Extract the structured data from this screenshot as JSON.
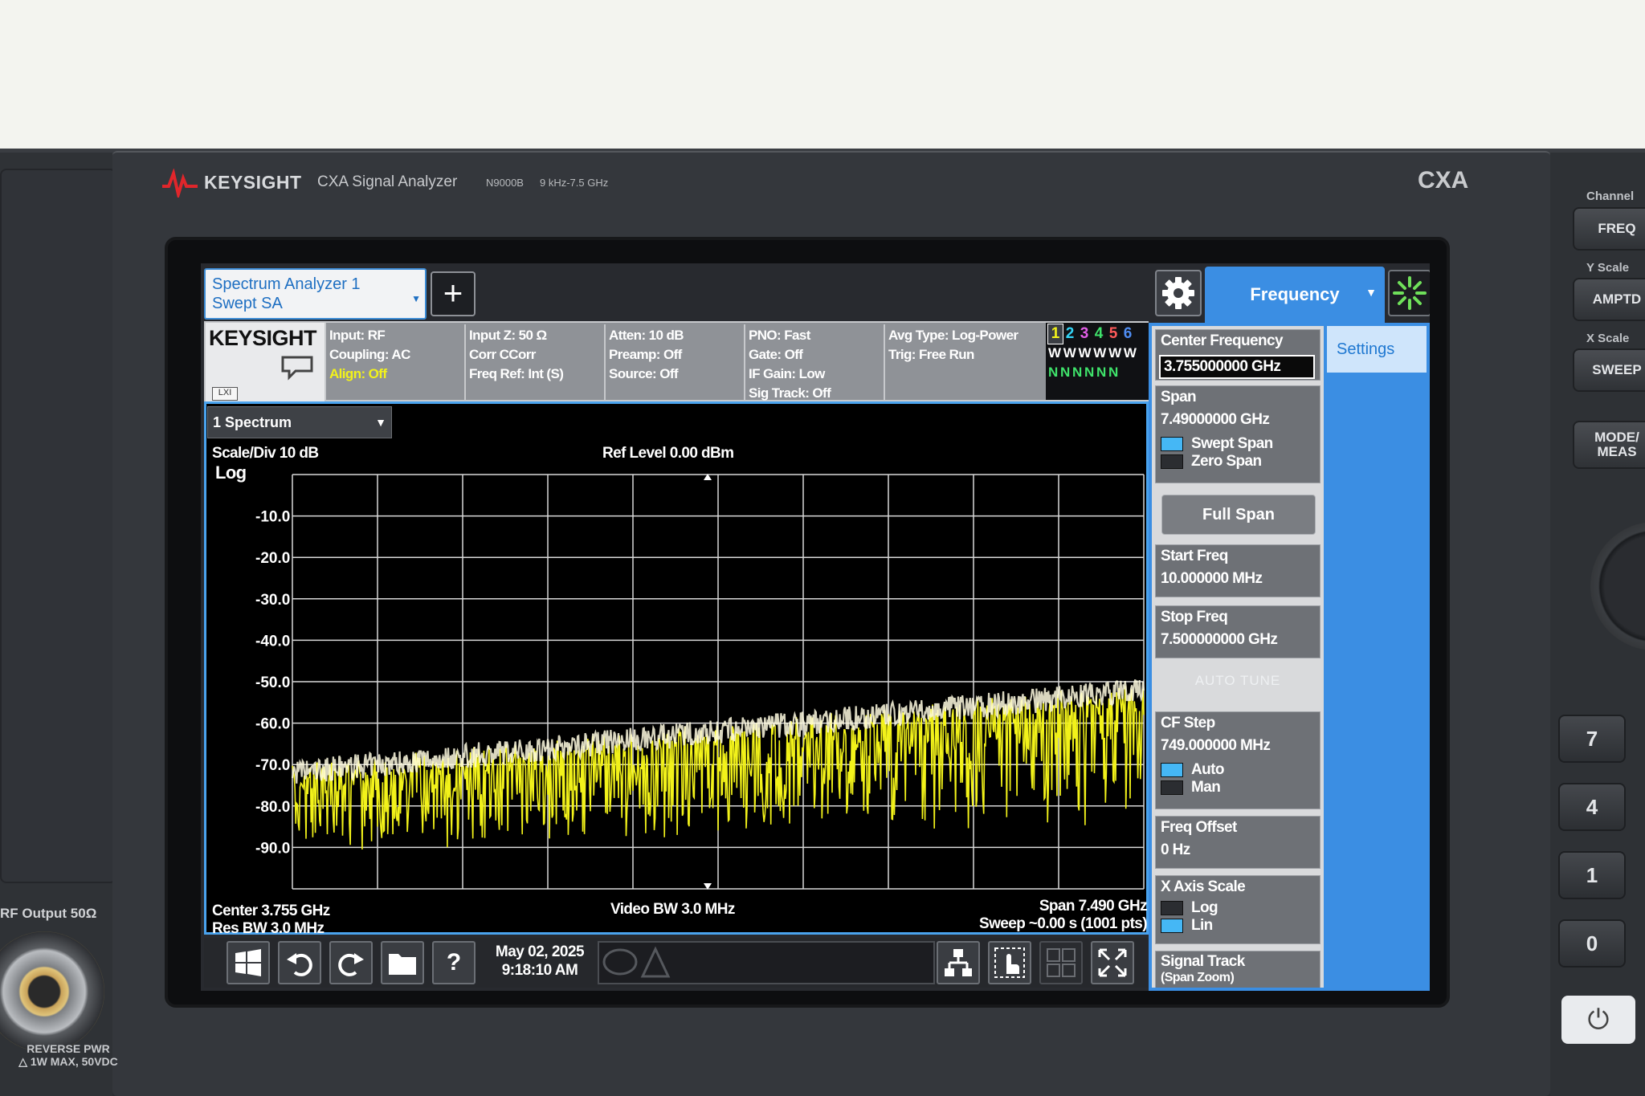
{
  "instrument": {
    "brand": "KEYSIGHT",
    "model_name": "CXA Signal Analyzer",
    "model_number": "N9000B",
    "range": "9 kHz-7.5 GHz",
    "series": "CXA",
    "rf_output_label": "RF Output 50Ω",
    "rf_warning_1": "REVERSE PWR",
    "rf_warning_2": "1W MAX, 50VDC"
  },
  "hardware_keys": {
    "groups": [
      {
        "label": "Channel",
        "key": "FREQ"
      },
      {
        "label": "Y Scale",
        "key": "AMPTD"
      },
      {
        "label": "X Scale",
        "key": "SWEEP"
      }
    ],
    "mode_meas": "MODE/ MEAS",
    "numbers": [
      "7",
      "4",
      "1",
      "0"
    ],
    "power": "⏻"
  },
  "screen": {
    "app_tab": {
      "line1": "Spectrum Analyzer 1",
      "line2": "Swept SA"
    },
    "add_button": "+",
    "menu_tab": "Frequency",
    "settings_tab": "Settings",
    "info_bar": {
      "logo": "KEYSIGHT",
      "lxi": "LXI",
      "col1": [
        "Input: RF",
        "Coupling: AC",
        "Align: Off"
      ],
      "col2": [
        "Input Z: 50 Ω",
        "Corr CCorr",
        "Freq Ref: Int (S)"
      ],
      "col3": [
        "Atten: 10 dB",
        "Preamp: Off",
        "Source: Off"
      ],
      "col4": [
        "PNO: Fast",
        "Gate: Off",
        "IF Gain: Low",
        "Sig Track: Off"
      ],
      "col5": [
        "Avg Type: Log-Power",
        "Trig: Free Run"
      ],
      "traces": [
        "1",
        "2",
        "3",
        "4",
        "5",
        "6"
      ],
      "trace_colors": [
        "#f2f21a",
        "#33d3f5",
        "#e35ee8",
        "#3fe36b",
        "#ff5a5a",
        "#4f8df2"
      ],
      "trace_types": "W W W W W W",
      "trace_dets": "N N N N N N"
    },
    "window": "1 Spectrum",
    "scale_div": "Scale/Div 10 dB",
    "log_label": "Log",
    "ref_level": "Ref Level 0.00 dBm",
    "center": "Center 3.755 GHz",
    "res_bw": "Res BW 3.0 MHz",
    "video_bw": "Video BW 3.0 MHz",
    "span": "Span 7.490 GHz",
    "sweep": "Sweep ~0.00 s (1001 pts)",
    "date": "May 02, 2025",
    "time": "9:18:10 AM"
  },
  "chart_data": {
    "type": "line",
    "ylabel": "Log",
    "yticks": [
      "-10.0",
      "-20.0",
      "-30.0",
      "-40.0",
      "-50.0",
      "-60.0",
      "-70.0",
      "-80.0",
      "-90.0"
    ],
    "ylim": [
      -100,
      0
    ],
    "xlim_ghz": [
      0.01,
      7.5
    ],
    "points": 1001,
    "trace_color": "#f2f21a",
    "noise_floor_dbm": {
      "start": -72,
      "end": -52
    },
    "noise_min_dbm": {
      "start": -88,
      "end": -80
    }
  },
  "menu": {
    "center_frequency": {
      "label": "Center Frequency",
      "value": "3.755000000 GHz"
    },
    "span": {
      "label": "Span",
      "value": "7.49000000 GHz",
      "options": [
        "Swept Span",
        "Zero Span"
      ]
    },
    "full_span": "Full Span",
    "start_freq": {
      "label": "Start Freq",
      "value": "10.000000 MHz"
    },
    "stop_freq": {
      "label": "Stop Freq",
      "value": "7.500000000 GHz"
    },
    "auto_tune": "AUTO TUNE",
    "cf_step": {
      "label": "CF Step",
      "value": "749.000000 MHz",
      "options": [
        "Auto",
        "Man"
      ]
    },
    "freq_offset": {
      "label": "Freq Offset",
      "value": "0 Hz"
    },
    "x_axis_scale": {
      "label": "X Axis Scale",
      "options": [
        "Log",
        "Lin"
      ]
    },
    "signal_track": {
      "label": "Signal Track",
      "sub": "(Span Zoom)"
    }
  }
}
